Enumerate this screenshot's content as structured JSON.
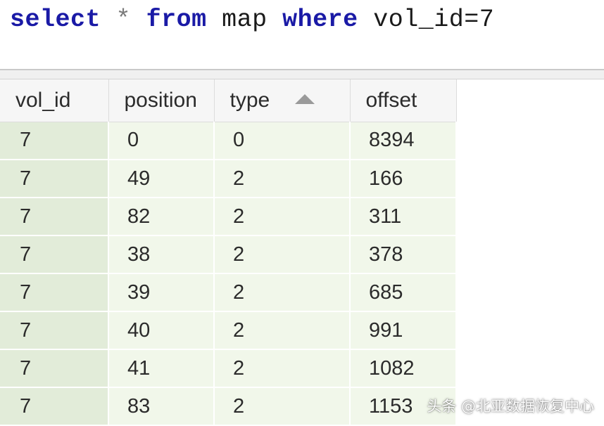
{
  "editor": {
    "tokens": [
      {
        "text": "select",
        "kind": "kw"
      },
      {
        "text": " ",
        "kind": "ident"
      },
      {
        "text": "*",
        "kind": "op"
      },
      {
        "text": " ",
        "kind": "ident"
      },
      {
        "text": "from",
        "kind": "kw"
      },
      {
        "text": " ",
        "kind": "ident"
      },
      {
        "text": "map",
        "kind": "ident"
      },
      {
        "text": " ",
        "kind": "ident"
      },
      {
        "text": "where",
        "kind": "kw"
      },
      {
        "text": " ",
        "kind": "ident"
      },
      {
        "text": "vol_id=7",
        "kind": "ident"
      }
    ]
  },
  "grid": {
    "columns": [
      "vol_id",
      "position",
      "type",
      "offset"
    ],
    "sorted_column": "type",
    "sort_direction": "ascending",
    "rows": [
      [
        "7",
        "0",
        "0",
        "8394"
      ],
      [
        "7",
        "49",
        "2",
        "166"
      ],
      [
        "7",
        "82",
        "2",
        "311"
      ],
      [
        "7",
        "38",
        "2",
        "378"
      ],
      [
        "7",
        "39",
        "2",
        "685"
      ],
      [
        "7",
        "40",
        "2",
        "991"
      ],
      [
        "7",
        "41",
        "2",
        "1082"
      ],
      [
        "7",
        "83",
        "2",
        "1153"
      ]
    ]
  },
  "watermark": "头条 @北亚数据恢复中心",
  "colors": {
    "keyword": "#1a1aa6",
    "row_background": "#f1f7ea",
    "first_column_background": "#e2ecd9",
    "header_background": "#f6f6f6"
  }
}
